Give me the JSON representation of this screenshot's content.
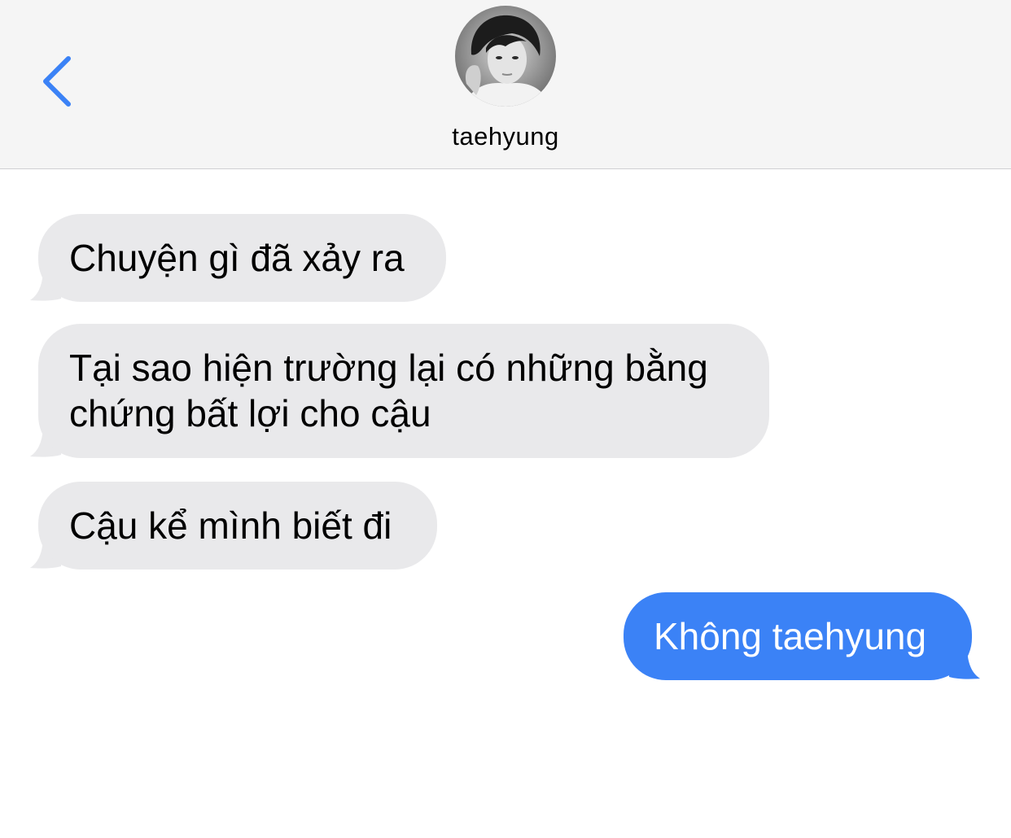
{
  "header": {
    "contact_name": "taehyung",
    "back_icon": "chevron-left-icon",
    "avatar_icon": "contact-avatar"
  },
  "colors": {
    "accent": "#3b82f6",
    "received_bubble": "#e9e9eb",
    "header_bg": "#f5f5f5"
  },
  "messages": [
    {
      "direction": "received",
      "lines": [
        "Chuyện gì đã xảy ra"
      ]
    },
    {
      "direction": "received",
      "lines": [
        "Tại sao hiện trường lại có những bằng",
        "chứng bất lợi cho cậu"
      ]
    },
    {
      "direction": "received",
      "lines": [
        "Cậu kể mình biết đi"
      ]
    },
    {
      "direction": "sent",
      "lines": [
        "Không taehyung"
      ]
    }
  ]
}
